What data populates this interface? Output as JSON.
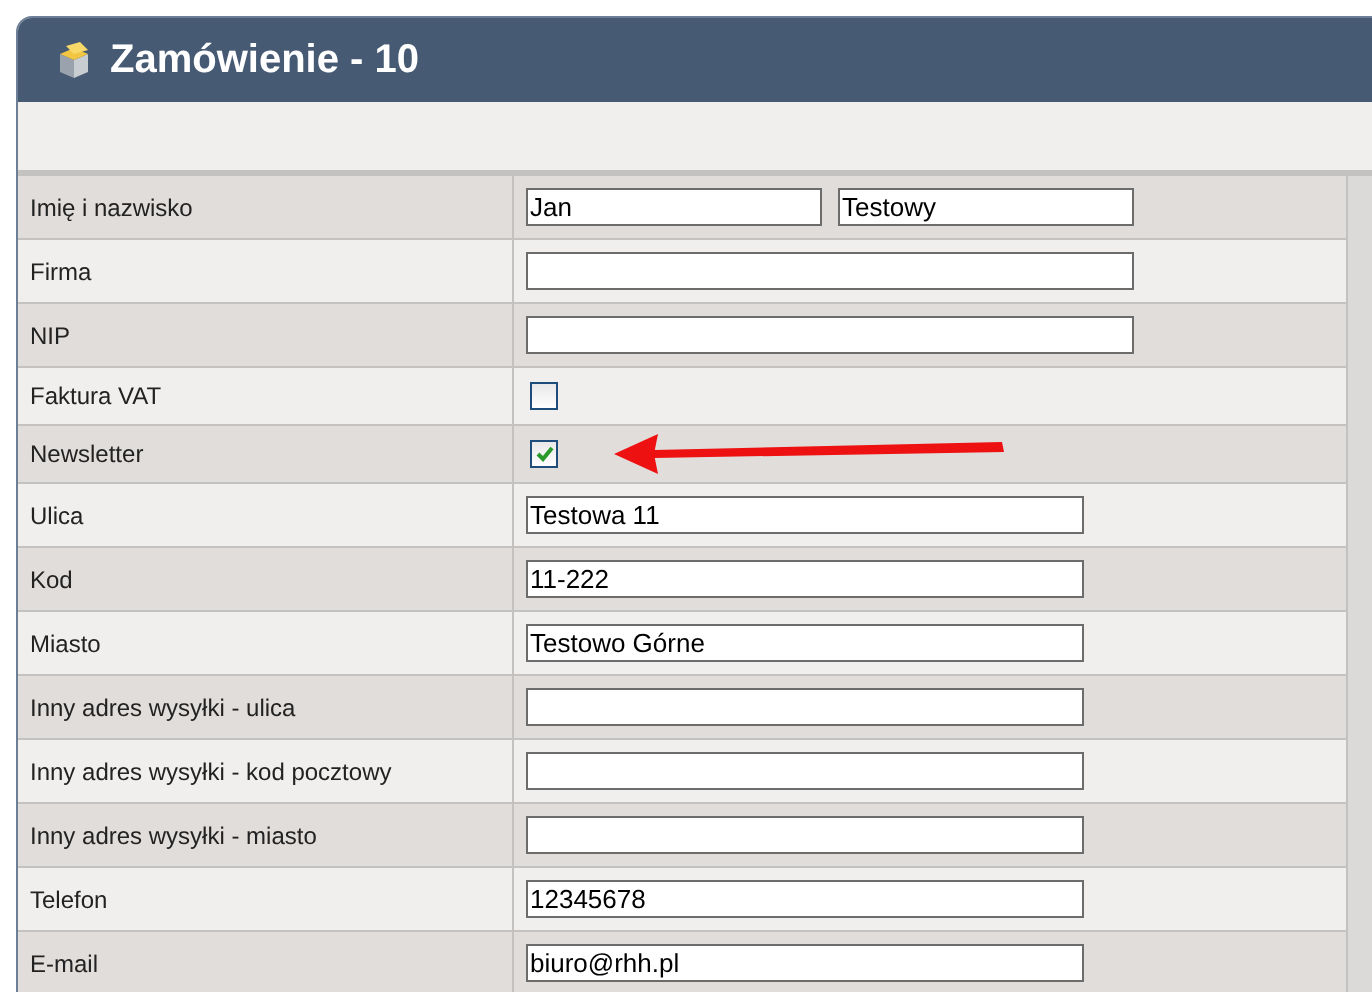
{
  "window": {
    "title": "Zamówienie - 10"
  },
  "rows": [
    {
      "label": "Imię i nazwisko",
      "kind": "pair",
      "values": [
        "Jan",
        "Testowy"
      ]
    },
    {
      "label": "Firma",
      "kind": "long",
      "values": []
    },
    {
      "label": "NIP",
      "kind": "long",
      "values": []
    },
    {
      "label": "Faktura VAT",
      "kind": "checkbox",
      "checked": false
    },
    {
      "label": "Newsletter",
      "kind": "checkbox",
      "checked": true
    },
    {
      "label": "Ulica",
      "kind": "short",
      "values": [
        "Testowa 11"
      ]
    },
    {
      "label": "Kod",
      "kind": "short",
      "values": [
        "11-222"
      ]
    },
    {
      "label": "Miasto",
      "kind": "short",
      "values": [
        "Testowo Górne"
      ]
    },
    {
      "label": "Inny adres wysyłki - ulica",
      "kind": "short",
      "values": []
    },
    {
      "label": "Inny adres wysyłki - kod pocztowy",
      "kind": "short",
      "values": []
    },
    {
      "label": "Inny adres wysyłki - miasto",
      "kind": "short",
      "values": []
    },
    {
      "label": "Telefon",
      "kind": "short",
      "values": [
        "12345678"
      ]
    },
    {
      "label": "E-mail",
      "kind": "short",
      "values": [
        "biuro@rhh.pl"
      ]
    }
  ]
}
